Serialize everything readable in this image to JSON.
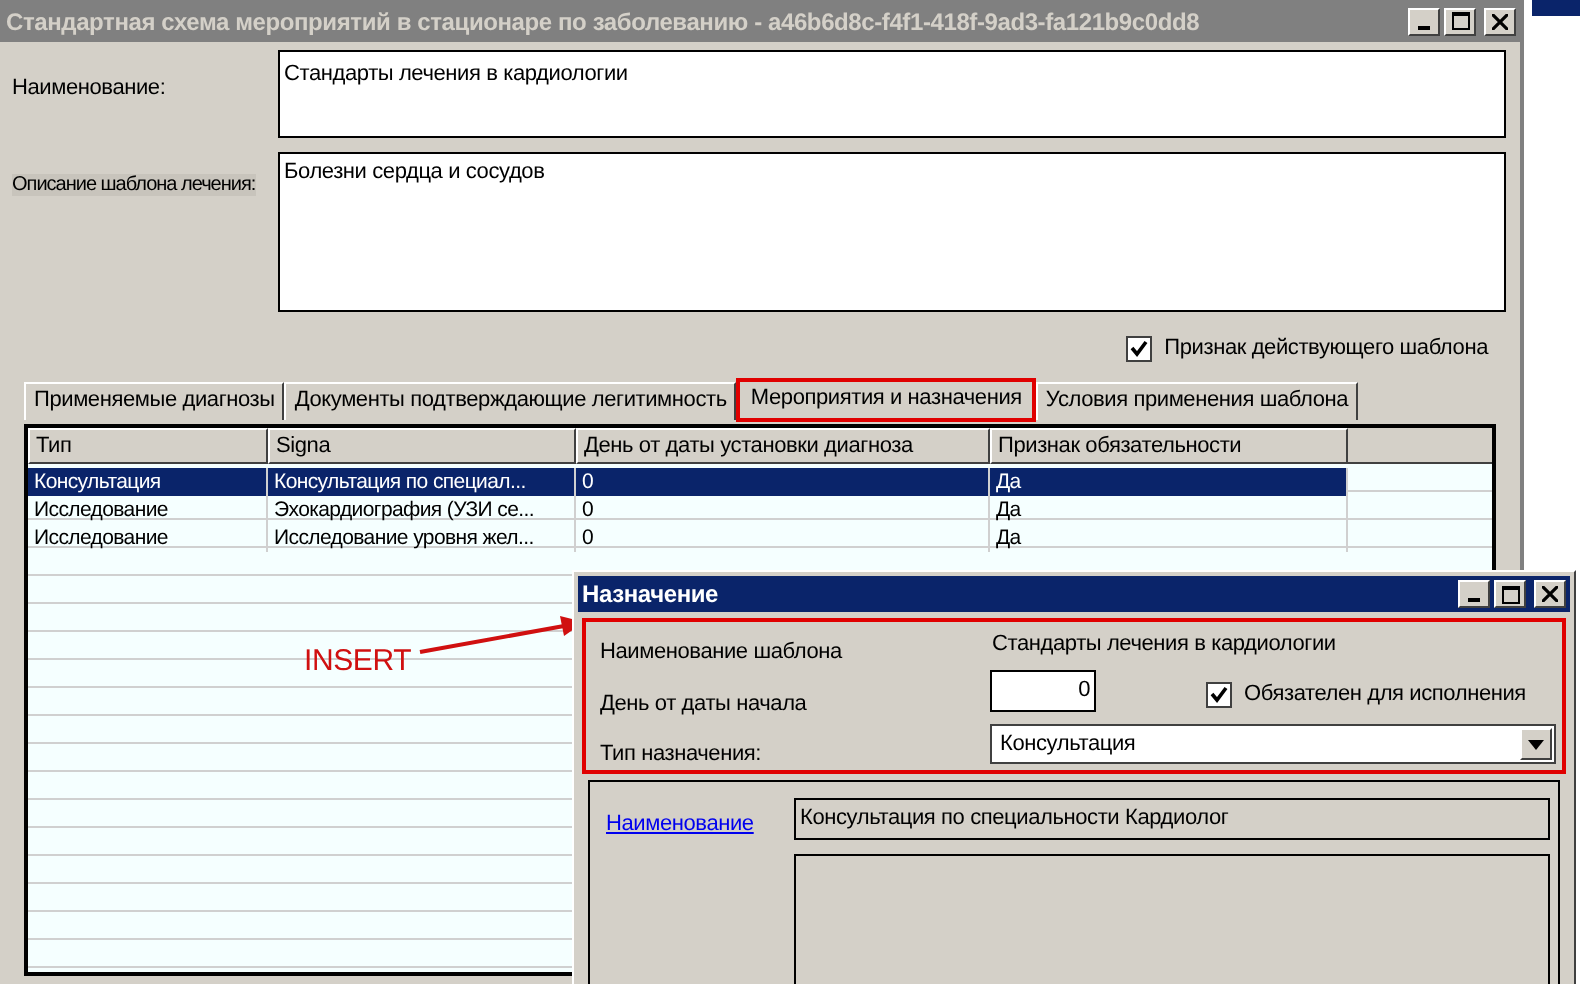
{
  "window": {
    "title": "Стандартная схема мероприятий в стационаре по заболеванию - a46b6d8c-f4f1-418f-9ad3-fa121b9c0dd8"
  },
  "name_field": {
    "label": "Наименование:",
    "value": "Стандарты лечения в кардиологии"
  },
  "description_field": {
    "label": "Описание шаблона лечения:",
    "value": "Болезни сердца и сосудов"
  },
  "active_checkbox": {
    "label": "Признак действующего шаблона",
    "checked": true
  },
  "tabs": [
    {
      "label": "Применяемые диагнозы",
      "selected": false,
      "highlighted": false
    },
    {
      "label": "Документы подтверждающие легитимность",
      "selected": false,
      "highlighted": false
    },
    {
      "label": "Мероприятия и назначения",
      "selected": true,
      "highlighted": true
    },
    {
      "label": "Условия применения шаблона",
      "selected": false,
      "highlighted": false
    }
  ],
  "table": {
    "columns": [
      "Тип",
      "Signa",
      "День от даты установки диагноза",
      "Признак обязательности"
    ],
    "rows": [
      {
        "cells": [
          "Консультация",
          "Консультация по специал...",
          "0",
          "Да"
        ],
        "selected": true
      },
      {
        "cells": [
          "Исследование",
          "Эхокардиография (УЗИ се...",
          "0",
          "Да"
        ],
        "selected": false
      },
      {
        "cells": [
          "Исследование",
          "Исследование уровня жел...",
          "0",
          "Да"
        ],
        "selected": false
      }
    ]
  },
  "annotation": {
    "text": "INSERT"
  },
  "dialog": {
    "title": "Назначение",
    "template_name": {
      "label": "Наименование шаблона",
      "value": "Стандарты лечения в кардиологии"
    },
    "start_day": {
      "label": "День от даты начала",
      "value": "0"
    },
    "mandatory_checkbox": {
      "label": "Обязателен для исполнения",
      "checked": true
    },
    "assignment_type": {
      "label": "Тип назначения:",
      "value": "Консультация"
    },
    "name_link": {
      "label": "Наименование",
      "value": "Консультация по специальности Кардиолог"
    }
  }
}
